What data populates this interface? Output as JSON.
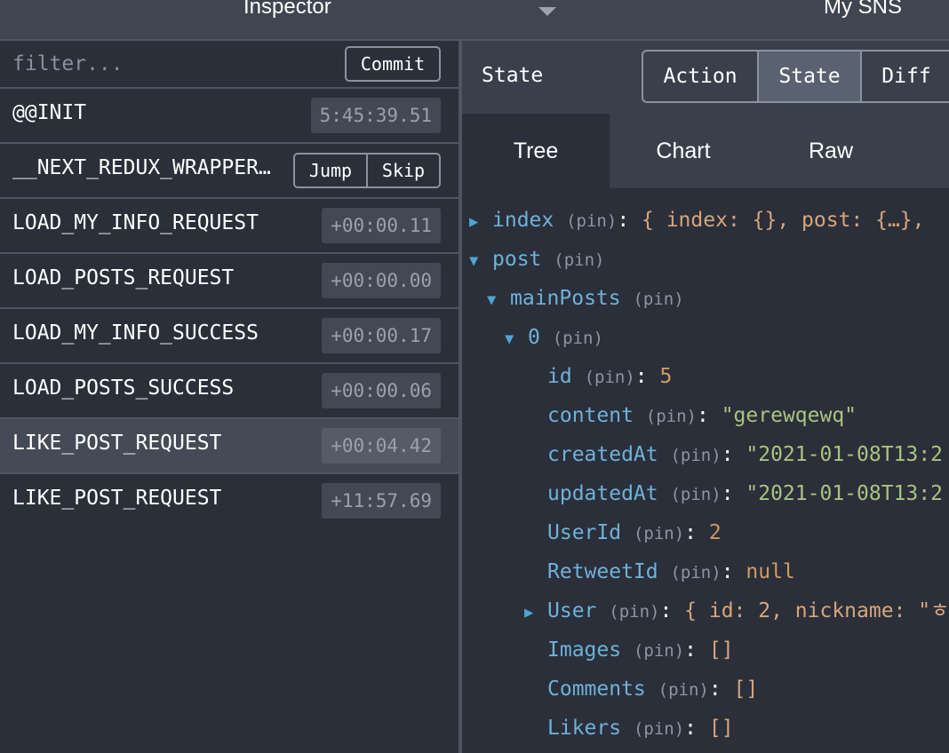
{
  "header": {
    "title": "Inspector",
    "instance": "My SNS"
  },
  "filter": {
    "placeholder": "filter...",
    "commit_label": "Commit"
  },
  "actions": [
    {
      "name": "@@INIT",
      "time": "5:45:39.51"
    },
    {
      "name": "__NEXT_REDUX_WRAPPER…",
      "jump": "Jump",
      "skip": "Skip"
    },
    {
      "name": "LOAD_MY_INFO_REQUEST",
      "time": "+00:00.11"
    },
    {
      "name": "LOAD_POSTS_REQUEST",
      "time": "+00:00.00"
    },
    {
      "name": "LOAD_MY_INFO_SUCCESS",
      "time": "+00:00.17"
    },
    {
      "name": "LOAD_POSTS_SUCCESS",
      "time": "+00:00.06"
    },
    {
      "name": "LIKE_POST_REQUEST",
      "time": "+00:04.42",
      "selected": true
    },
    {
      "name": "LIKE_POST_REQUEST",
      "time": "+11:57.69"
    }
  ],
  "state_panel": {
    "label": "State",
    "modes": [
      "Action",
      "State",
      "Diff"
    ],
    "active_mode": "State",
    "tabs": [
      "Tree",
      "Chart",
      "Raw"
    ],
    "active_tab": "Tree"
  },
  "tree": {
    "pin": "(pin)",
    "index_key": "index",
    "index_preview": "{ index: {}, post: {…},",
    "post_key": "post",
    "mainPosts_key": "mainPosts",
    "item0_key": "0",
    "id_key": "id",
    "id_value": "5",
    "content_key": "content",
    "content_value": "\"gerewqewq\"",
    "createdAt_key": "createdAt",
    "createdAt_value": "\"2021-01-08T13:2",
    "updatedAt_key": "updatedAt",
    "updatedAt_value": "\"2021-01-08T13:2",
    "UserId_key": "UserId",
    "UserId_value": "2",
    "RetweetId_key": "RetweetId",
    "RetweetId_value": "null",
    "User_key": "User",
    "User_preview": "{ id: 2, nickname: \"ㅎ",
    "Images_key": "Images",
    "Images_value": "[]",
    "Comments_key": "Comments",
    "Comments_value": "[]",
    "Likers_key": "Likers",
    "Likers_value": "[]"
  },
  "colors": {
    "background": "#2a2f3a",
    "key": "#6fb1d9",
    "string": "#a9c47f",
    "number": "#d39a5f"
  }
}
